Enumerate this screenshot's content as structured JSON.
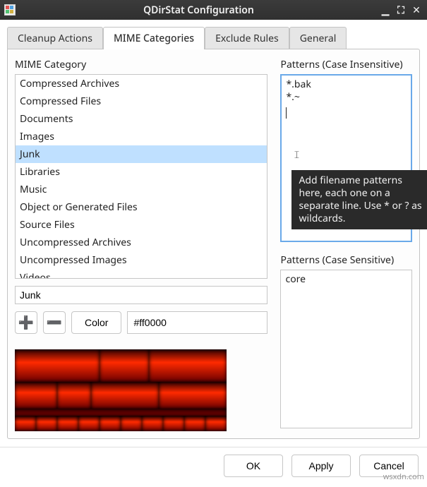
{
  "window": {
    "title": "QDirStat Configuration"
  },
  "tabs": [
    {
      "label": "Cleanup Actions"
    },
    {
      "label": "MIME Categories"
    },
    {
      "label": "Exclude Rules"
    },
    {
      "label": "General"
    }
  ],
  "active_tab": 1,
  "left": {
    "heading": "MIME Category",
    "items": [
      "Compressed Archives",
      "Compressed Files",
      "Documents",
      "Images",
      "Junk",
      "Libraries",
      "Music",
      "Object or Generated Files",
      "Source Files",
      "Uncompressed Archives",
      "Uncompressed Images",
      "Videos"
    ],
    "selected_index": 4,
    "name_value": "Junk",
    "color_button": "Color",
    "color_value": "#ff0000"
  },
  "right": {
    "heading_insensitive": "Patterns (Case Insensitive)",
    "patterns_insensitive": "*.bak\n*.~\n",
    "tooltip": "Add filename patterns here, each one on a separate line. Use * or ? as wildcards.",
    "heading_sensitive": "Patterns (Case Sensitive)",
    "patterns_sensitive": "core"
  },
  "buttons": {
    "ok": "OK",
    "apply": "Apply",
    "cancel": "Cancel"
  },
  "watermark": "wsxdn.com"
}
